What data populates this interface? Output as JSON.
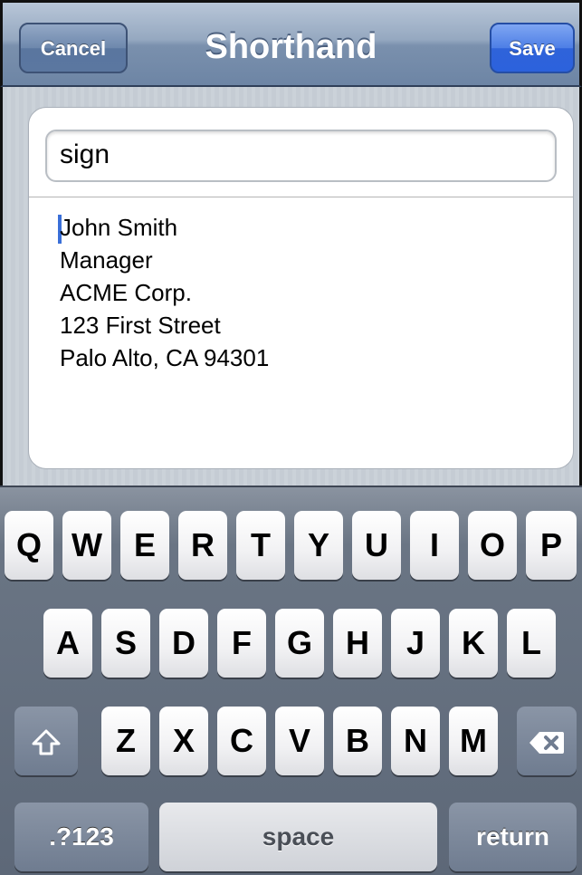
{
  "navbar": {
    "title": "Shorthand",
    "cancel_label": "Cancel",
    "save_label": "Save"
  },
  "editor": {
    "abbreviation_value": "sign",
    "expansion_lines": [
      "John Smith",
      "Manager",
      "ACME Corp.",
      "123 First Street",
      "Palo Alto, CA 94301"
    ]
  },
  "keyboard": {
    "row1": [
      "Q",
      "W",
      "E",
      "R",
      "T",
      "Y",
      "U",
      "I",
      "O",
      "P"
    ],
    "row2": [
      "A",
      "S",
      "D",
      "F",
      "G",
      "H",
      "J",
      "K",
      "L"
    ],
    "row3": [
      "Z",
      "X",
      "C",
      "V",
      "B",
      "N",
      "M"
    ],
    "shift_icon": "shift-arrow-icon",
    "delete_icon": "backspace-icon",
    "numbers_label": ".?123",
    "space_label": "space",
    "return_label": "return"
  },
  "colors": {
    "nav_bar": "#7a90ad",
    "save_button": "#2f63da",
    "caret": "#3a6fd8",
    "keyboard_bg": "#5d6878"
  }
}
